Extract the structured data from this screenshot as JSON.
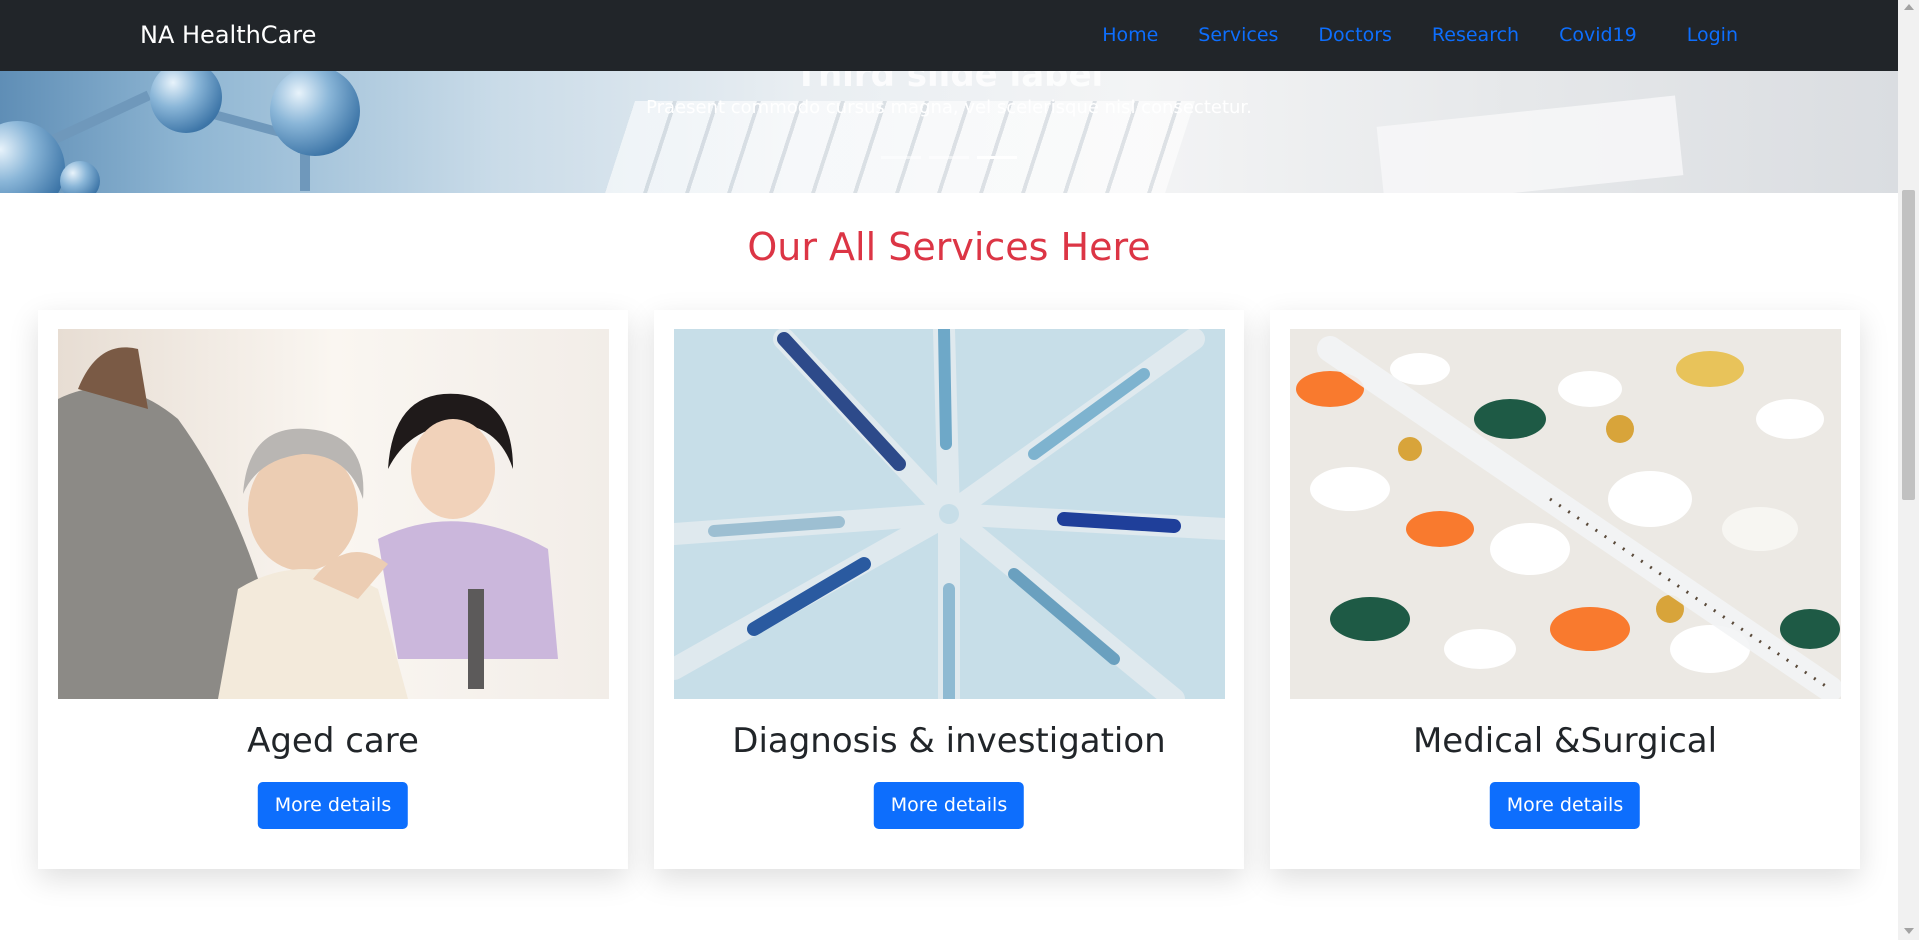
{
  "navbar": {
    "brand": "NA HealthCare",
    "links": [
      "Home",
      "Services",
      "Doctors",
      "Research",
      "Covid19"
    ],
    "login": "Login",
    "background": "#212529",
    "link_color": "#0d6efd"
  },
  "carousel": {
    "title": "Third slide label",
    "text": "Praesent commodo cursus magna, vel scelerisque nisl consectetur.",
    "active_slide": 3,
    "slide_count": 3
  },
  "services": {
    "heading": "Our All Services Here",
    "heading_color": "#dc3545",
    "cards": [
      {
        "title": "Aged care",
        "button": "More details",
        "image": "elderly-care-photo"
      },
      {
        "title": "Diagnosis & investigation",
        "button": "More details",
        "image": "syringes-photo"
      },
      {
        "title": "Medical &Surgical",
        "button": "More details",
        "image": "pills-thermometer-photo"
      }
    ],
    "button_color": "#0d6efd"
  }
}
